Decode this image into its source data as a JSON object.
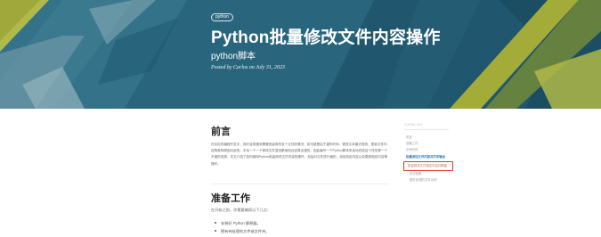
{
  "hero": {
    "tag": "python",
    "title": "Python批量修改文件内容操作",
    "subtitle": "python脚本",
    "meta": "Posted by Carlos on July 31, 2023"
  },
  "article": {
    "section1_heading": "前言",
    "section1_body": "在实际的编程开发中，我们经常遇到需要批量修改多个文件的情况，如可能是由于重构代码、更改文本格式规则、更新文件内容等各种原因引起的。手动一个一个修改文件显然繁琐而且容易出错的，因此编写一个Python脚本来自动完成这个任务是一个不错的选择。本文介绍了如何使用Python批量修改文件内容的操作，包括对文件进行遍历、添加特定内容以及更新指定内容等操作。",
    "section2_heading": "准备工作",
    "section2_intro": "在开始之前，你需要确保以下几点：",
    "section2_items": [
      "安装好 Python 解释器。",
      "拥有待处理的文件或文件夹。"
    ]
  },
  "catalog": {
    "title": "CATALOG",
    "items": [
      "前言",
      "准备工作",
      "示例代码",
      "批量添加文件内容并打印输出",
      "批量修改文件指定内容并覆盖",
      "执行效果",
      "额外处理的文件示例"
    ]
  }
}
